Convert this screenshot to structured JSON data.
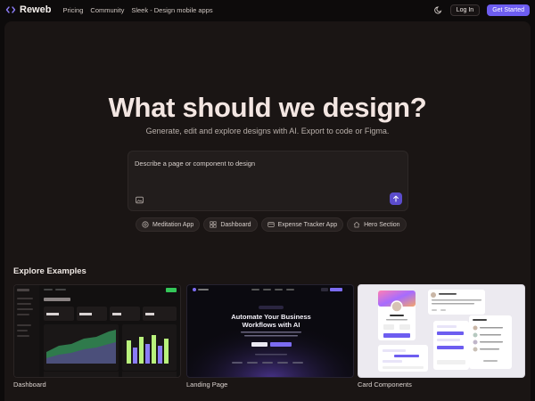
{
  "nav": {
    "brand": "Reweb",
    "links": [
      "Pricing",
      "Community",
      "Sleek - Design mobile apps"
    ],
    "login": "Log In",
    "get_started": "Get Started"
  },
  "hero": {
    "title": "What should we design?",
    "subtitle": "Generate, edit and explore designs with AI. Export to code or Figma."
  },
  "prompt": {
    "placeholder": "Describe a page or component to design"
  },
  "chips": [
    {
      "label": "Meditation App",
      "icon": "meditation-icon"
    },
    {
      "label": "Dashboard",
      "icon": "grid-icon"
    },
    {
      "label": "Expense Tracker App",
      "icon": "wallet-icon"
    },
    {
      "label": "Hero Section",
      "icon": "home-icon"
    }
  ],
  "explore": {
    "title": "Explore Examples",
    "cards": [
      {
        "label": "Dashboard"
      },
      {
        "label": "Landing Page",
        "headline": "Automate Your Business Workflows with AI"
      },
      {
        "label": "Card Components"
      }
    ]
  },
  "colors": {
    "accent": "#6d5df0",
    "background": "#0d0b0b",
    "panel": "#1a1514"
  }
}
